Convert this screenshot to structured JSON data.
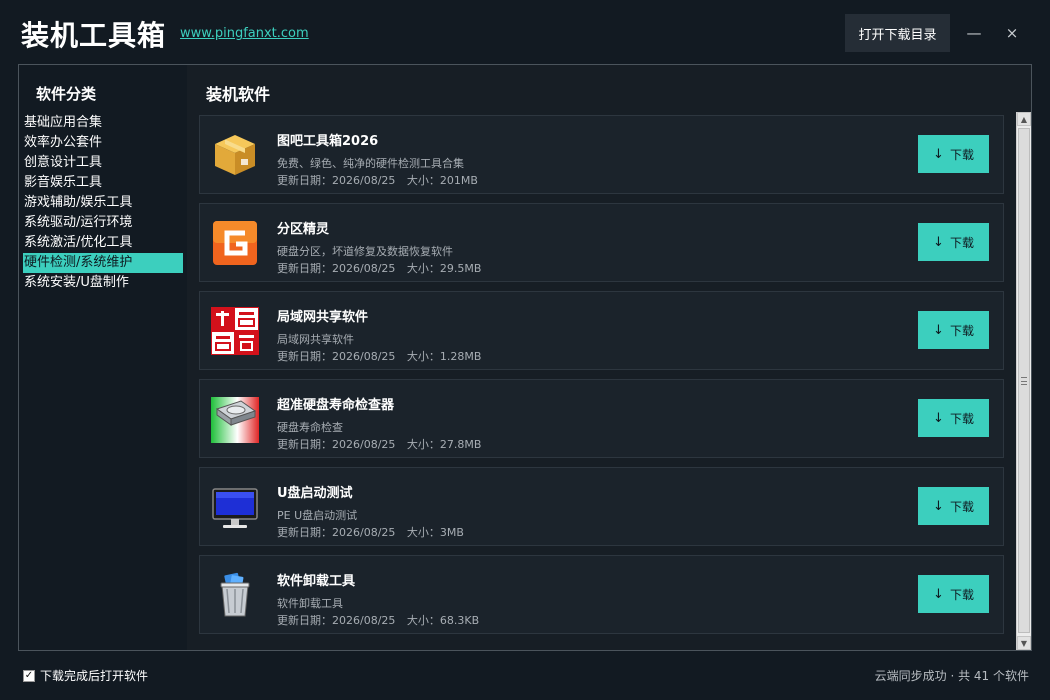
{
  "header": {
    "app_title": "装机工具箱",
    "site_link": "www.pingfanxt.com",
    "open_dir_label": "打开下载目录",
    "minimize_glyph": "—",
    "close_glyph": "×"
  },
  "sidebar": {
    "title": "软件分类",
    "items": [
      {
        "label": "基础应用合集",
        "active": false
      },
      {
        "label": "效率办公套件",
        "active": false
      },
      {
        "label": "创意设计工具",
        "active": false
      },
      {
        "label": "影音娱乐工具",
        "active": false
      },
      {
        "label": "游戏辅助/娱乐工具",
        "active": false
      },
      {
        "label": "系统驱动/运行环境",
        "active": false
      },
      {
        "label": "系统激活/优化工具",
        "active": false
      },
      {
        "label": "硬件检测/系统维护",
        "active": true
      },
      {
        "label": "系统安装/U盘制作",
        "active": false
      }
    ]
  },
  "content": {
    "title": "装机软件",
    "date_prefix": "更新日期：",
    "size_prefix": "大小：",
    "download_label": "下载",
    "items": [
      {
        "name": "图吧工具箱2026",
        "desc": "免费、绿色、纯净的硬件检测工具合集",
        "date": "2026/08/25",
        "size": "201MB",
        "icon": "package-box-icon"
      },
      {
        "name": "分区精灵",
        "desc": "硬盘分区，坏道修复及数据恢复软件",
        "date": "2026/08/25",
        "size": "29.5MB",
        "icon": "diskgenius-icon"
      },
      {
        "name": "局域网共享软件",
        "desc": "局域网共享软件",
        "date": "2026/08/25",
        "size": "1.28MB",
        "icon": "52pojie-seal-icon"
      },
      {
        "name": "超准硬盘寿命检查器",
        "desc": "硬盘寿命检查",
        "date": "2026/08/25",
        "size": "27.8MB",
        "icon": "hard-drive-icon"
      },
      {
        "name": "U盘启动测试",
        "desc": "PE U盘启动测试",
        "date": "2026/08/25",
        "size": "3MB",
        "icon": "monitor-icon"
      },
      {
        "name": "软件卸载工具",
        "desc": "软件卸载工具",
        "date": "2026/08/25",
        "size": "68.3KB",
        "icon": "trash-bin-icon"
      }
    ]
  },
  "footer": {
    "open_after_download_label": "下载完成后打开软件",
    "open_after_download_checked": true,
    "status": "云端同步成功 · 共 41 个软件"
  },
  "colors": {
    "background": "#121a22",
    "accent": "#3ccfbe",
    "card": "#1b232b"
  }
}
